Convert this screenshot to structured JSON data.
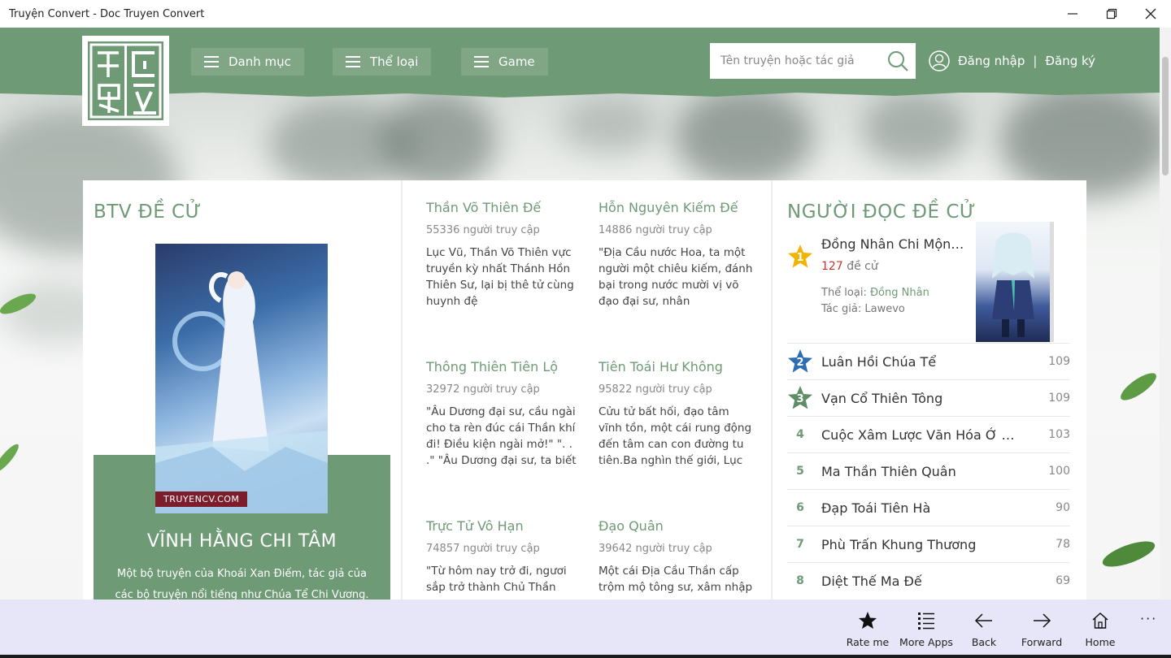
{
  "window": {
    "title": "Truyện Convert - Doc Truyen Convert",
    "icons": [
      "minimize-icon",
      "maximize-icon",
      "close-icon"
    ]
  },
  "colors": {
    "brand": "#6f9a76",
    "header": "#6f9a76",
    "appbar": "#e6e6f8",
    "accent_red": "#c0392b",
    "star_gold": "#f2b400",
    "star_blue": "#2d6db4",
    "star_green": "#5d8e68"
  },
  "header": {
    "nav": [
      {
        "label": "Danh mục",
        "icon": "hamburger-icon"
      },
      {
        "label": "Thể loại",
        "icon": "hamburger-icon"
      },
      {
        "label": "Game",
        "icon": "hamburger-icon"
      }
    ],
    "search": {
      "placeholder": "Tên truyện hoặc tác giả",
      "icon": "search-icon"
    },
    "user": {
      "icon": "user-icon",
      "login": "Đăng nhập",
      "sep": "|",
      "register": "Đăng ký"
    }
  },
  "btv": {
    "title": "BTV ĐỀ CỬ",
    "cover_watermark": "TRUYENCV.COM",
    "name": "VĨNH HẰNG CHI TÂM",
    "desc": "Một bộ truyện của Khoái Xan Điếm, tác giả của các bộ truyện nổi tiếng như Chúa Tể Chi Vương."
  },
  "stories": [
    {
      "name": "Thần Võ Thiên Đế",
      "views": "55336 người truy cập",
      "desc": "Lục Vũ, Thần Võ Thiên vực truyền kỳ nhất Thánh Hồn Thiên Sư, lại bị thê tử cùng huynh đệ"
    },
    {
      "name": "Hỗn Nguyên Kiếm Đế",
      "views": "14886 người truy cập",
      "desc": "\"Địa Cầu nước Hoa, ta một người một chiêu kiếm, đánh bại trong nước mười vị võ đạo đại sư, nhân"
    },
    {
      "name": "Thông Thiên Tiên Lộ",
      "views": "32972 người truy cập",
      "desc": "\"Âu Dương đại sư, cầu ngài cho ta rèn đúc cái Thần khí đi! Điều kiện ngài mở!\" \". . .\" \"Âu Dương đại sư, ta biết"
    },
    {
      "name": "Tiên Toái Hư Không",
      "views": "95822 người truy cập",
      "desc": "Cửu tử bất hối, đạo tâm vĩnh tồn, một cái rung động đến tâm can con đường tu tiên.Ba nghìn thế giới, Lục"
    },
    {
      "name": "Trực Tử Vô Hạn",
      "views": "74857 người truy cập",
      "desc": "\"Từ hôm nay trở đi, ngươi sắp trở thành Chủ Thần"
    },
    {
      "name": "Đạo Quân",
      "views": "39642 người truy cập",
      "desc": "Một cái Địa Cầu Thần cấp trộm mộ tông sư, xâm nhập"
    }
  ],
  "reader": {
    "title": "NGƯỜI ĐỌC ĐỀ CỬ",
    "top1": {
      "rank": "1",
      "name": "Đồng Nhân Chi Mộng T...",
      "count": "127",
      "count_label": "đề cử",
      "genre_label": "Thể loại:",
      "genre": "Đồng Nhân",
      "author_label": "Tác giả:",
      "author": "Lawevo"
    },
    "ranks": [
      {
        "rank": "2",
        "name": "Luân Hồi Chúa Tể",
        "value": "109"
      },
      {
        "rank": "3",
        "name": "Vạn Cổ Thiên Tông",
        "value": "109"
      },
      {
        "rank": "4",
        "name": "Cuộc Xâm Lược Văn Hóa Ở Thế...",
        "value": "103"
      },
      {
        "rank": "5",
        "name": "Ma Thần Thiên Quân",
        "value": "100"
      },
      {
        "rank": "6",
        "name": "Đạp Toái Tiên Hà",
        "value": "90"
      },
      {
        "rank": "7",
        "name": "Phù Trấn Khung Thương",
        "value": "78"
      },
      {
        "rank": "8",
        "name": "Diệt Thế Ma Đế",
        "value": "69"
      }
    ]
  },
  "appbar": {
    "buttons": [
      {
        "label": "Rate me",
        "icon": "star-icon"
      },
      {
        "label": "More Apps",
        "icon": "list-icon"
      },
      {
        "label": "Back",
        "icon": "back-arrow-icon"
      },
      {
        "label": "Forward",
        "icon": "forward-arrow-icon"
      },
      {
        "label": "Home",
        "icon": "home-icon"
      }
    ],
    "more": "···"
  }
}
